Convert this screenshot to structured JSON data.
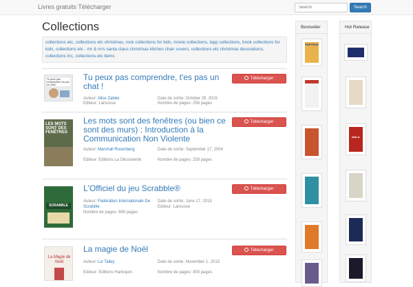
{
  "nav": {
    "brand": "Livres gratuits Télécharger",
    "search_placeholder": "Search",
    "search_button": "Search"
  },
  "page_title": "Collections",
  "tags": [
    "collections etc",
    "collections etc christmas",
    "rock collections for kids",
    "movie collections",
    "tapp collections",
    "book collections for kids",
    "collections etc - mr & mrs santa claus christmas kitchen chair covers",
    "collections etc christmas decorations",
    "collections inc",
    "collections etc items"
  ],
  "download_label": "Télécharger",
  "labels": {
    "author": "Auteur:",
    "publisher": "Editeur:",
    "release": "Date de sortie:",
    "pages": "Nombre de pages:"
  },
  "books": [
    {
      "title": "Tu peux pas comprendre, t'es pas un chat !",
      "author": "Alice Zabée",
      "publisher": "Larousse",
      "release": "October 28, 2015",
      "pages": "256 pages",
      "cover_text": "Tu peux pas comprendre t'es pas un chat!"
    },
    {
      "title": "Les mots sont des fenêtres (ou bien ce sont des murs) : Introduction à la Communication Non Violente",
      "author": "Marshall Rosenberg",
      "publisher": "Editions La Découverte",
      "release": "September 17, 2004",
      "pages": "259 pages",
      "cover_text": "LES MOTS SONT DES FENÊTRES"
    },
    {
      "title": "L'Officiel du jeu Scrabble®",
      "author": "Fédération Internationale De Scrabble",
      "publisher": "Larousse",
      "release": "June 17, 2015",
      "pages": "896 pages",
      "cover_text": "SCRABBLE"
    },
    {
      "title": "La magie de Noël",
      "author": "Liz Talley",
      "publisher": "Editions Harlequin",
      "release": "November 1, 2015",
      "pages": "400 pages",
      "cover_text": "La Magie de Noël"
    }
  ],
  "sidebar": {
    "bestseller_label": "Bestseller",
    "hot_release_label": "Hot Release",
    "bestseller_covers": [
      "PAPYRUS"
    ],
    "hot_release_covers": [
      "MALA VIDA"
    ]
  },
  "colors": {
    "link": "#337ab7",
    "download": "#d9534f",
    "search_button": "#337ab7"
  }
}
